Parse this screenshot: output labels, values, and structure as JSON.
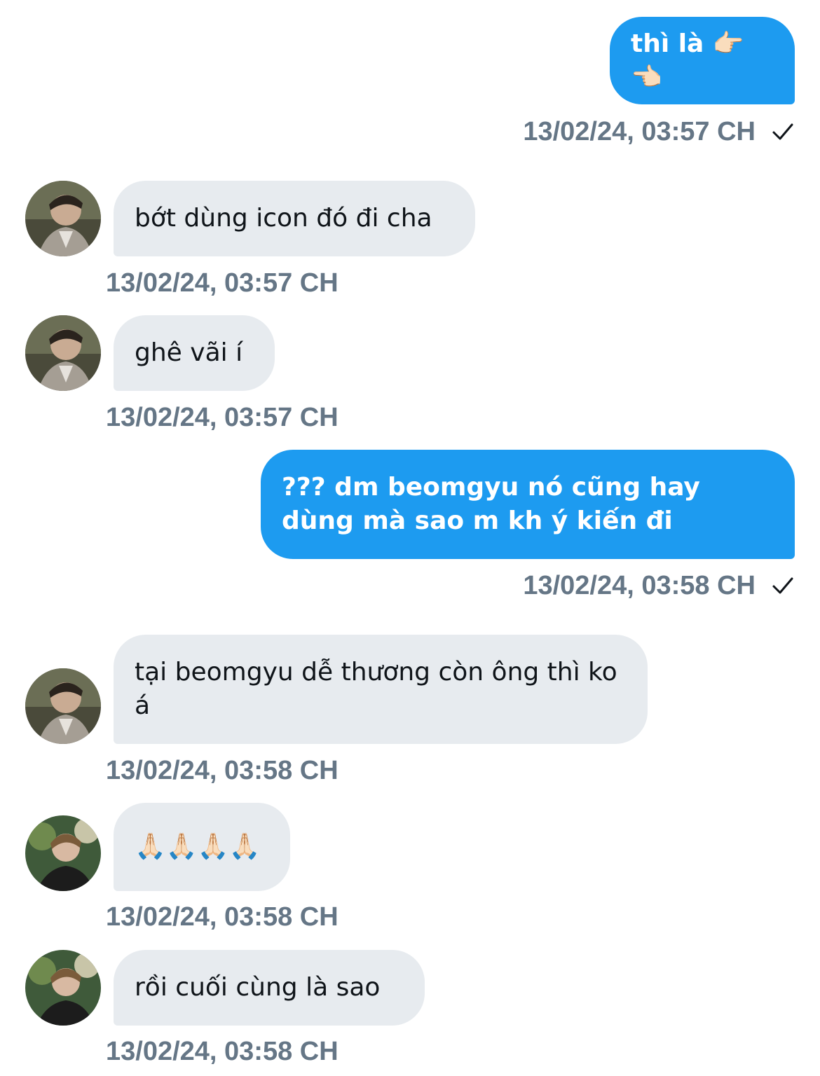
{
  "messages": [
    {
      "direction": "out",
      "text": "thì là 👉🏻👈🏻",
      "timestamp": "13/02/24, 03:57 CH",
      "status_icon": "checkmark-icon"
    },
    {
      "direction": "in",
      "avatar": "avatar-a",
      "text": "bớt dùng icon đó đi cha",
      "timestamp": "13/02/24, 03:57 CH"
    },
    {
      "direction": "in",
      "avatar": "avatar-a",
      "text": "ghê vãi í",
      "timestamp": "13/02/24, 03:57 CH"
    },
    {
      "direction": "out",
      "text": "??? dm beomgyu nó cũng hay dùng mà sao m kh ý kiến đi",
      "timestamp": "13/02/24, 03:58 CH",
      "status_icon": "checkmark-icon"
    },
    {
      "direction": "in",
      "avatar": "avatar-a",
      "text": "tại beomgyu dễ thương còn ông thì ko á",
      "timestamp": "13/02/24, 03:58 CH"
    },
    {
      "direction": "in",
      "avatar": "avatar-b",
      "text": "🙏🏻🙏🏻🙏🏻🙏🏻",
      "timestamp": "13/02/24, 03:58 CH"
    },
    {
      "direction": "in",
      "avatar": "avatar-b",
      "text": "rồi cuối cùng là sao",
      "timestamp": "13/02/24, 03:58 CH"
    }
  ],
  "colors": {
    "outgoing_bubble": "#1d9bf0",
    "incoming_bubble": "#e7ebef",
    "timestamp": "#657686",
    "incoming_text": "#0f1419"
  }
}
